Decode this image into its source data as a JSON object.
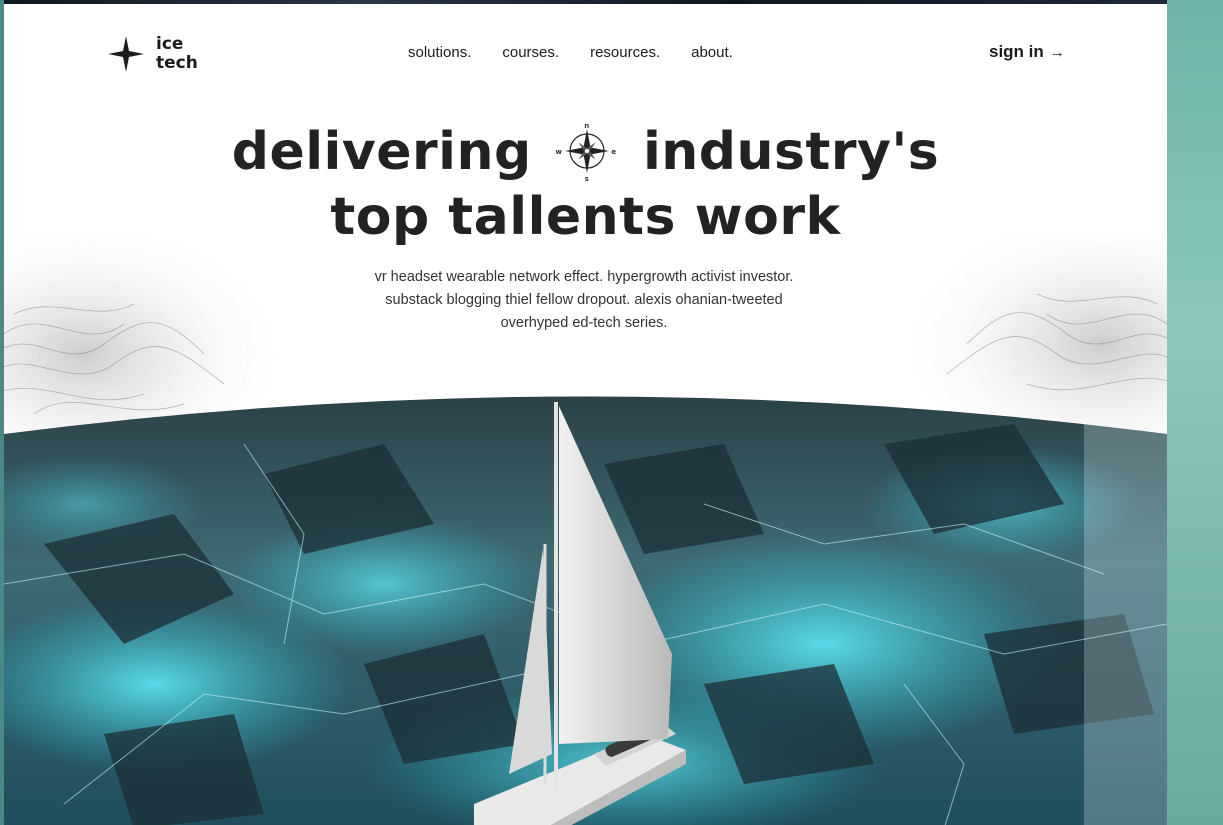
{
  "brand": {
    "line1": "ice",
    "line2": "tech"
  },
  "nav": {
    "items": [
      {
        "label": "solutions."
      },
      {
        "label": "courses."
      },
      {
        "label": "resources."
      },
      {
        "label": "about."
      }
    ]
  },
  "signin": {
    "label": "sign in",
    "arrow": "→"
  },
  "hero": {
    "title_part1": "delivering",
    "title_part2": "industry's",
    "title_line2": "top tallents work",
    "compass": {
      "n": "n",
      "s": "s",
      "e": "e",
      "w": "w"
    },
    "subtitle": "vr headset wearable network effect. hypergrowth activist investor. substack blogging thiel fellow dropout. alexis ohanian-tweeted overhyped ed-tech series."
  },
  "icons": {
    "logo": "compass-star-icon",
    "arrow": "arrow-right-icon",
    "title_compass": "compass-rose-icon"
  },
  "colors": {
    "text": "#222222",
    "accent_ice": "#2fbfd0",
    "page_bg": "#ffffff",
    "side_panel": "#7fbdb2"
  }
}
